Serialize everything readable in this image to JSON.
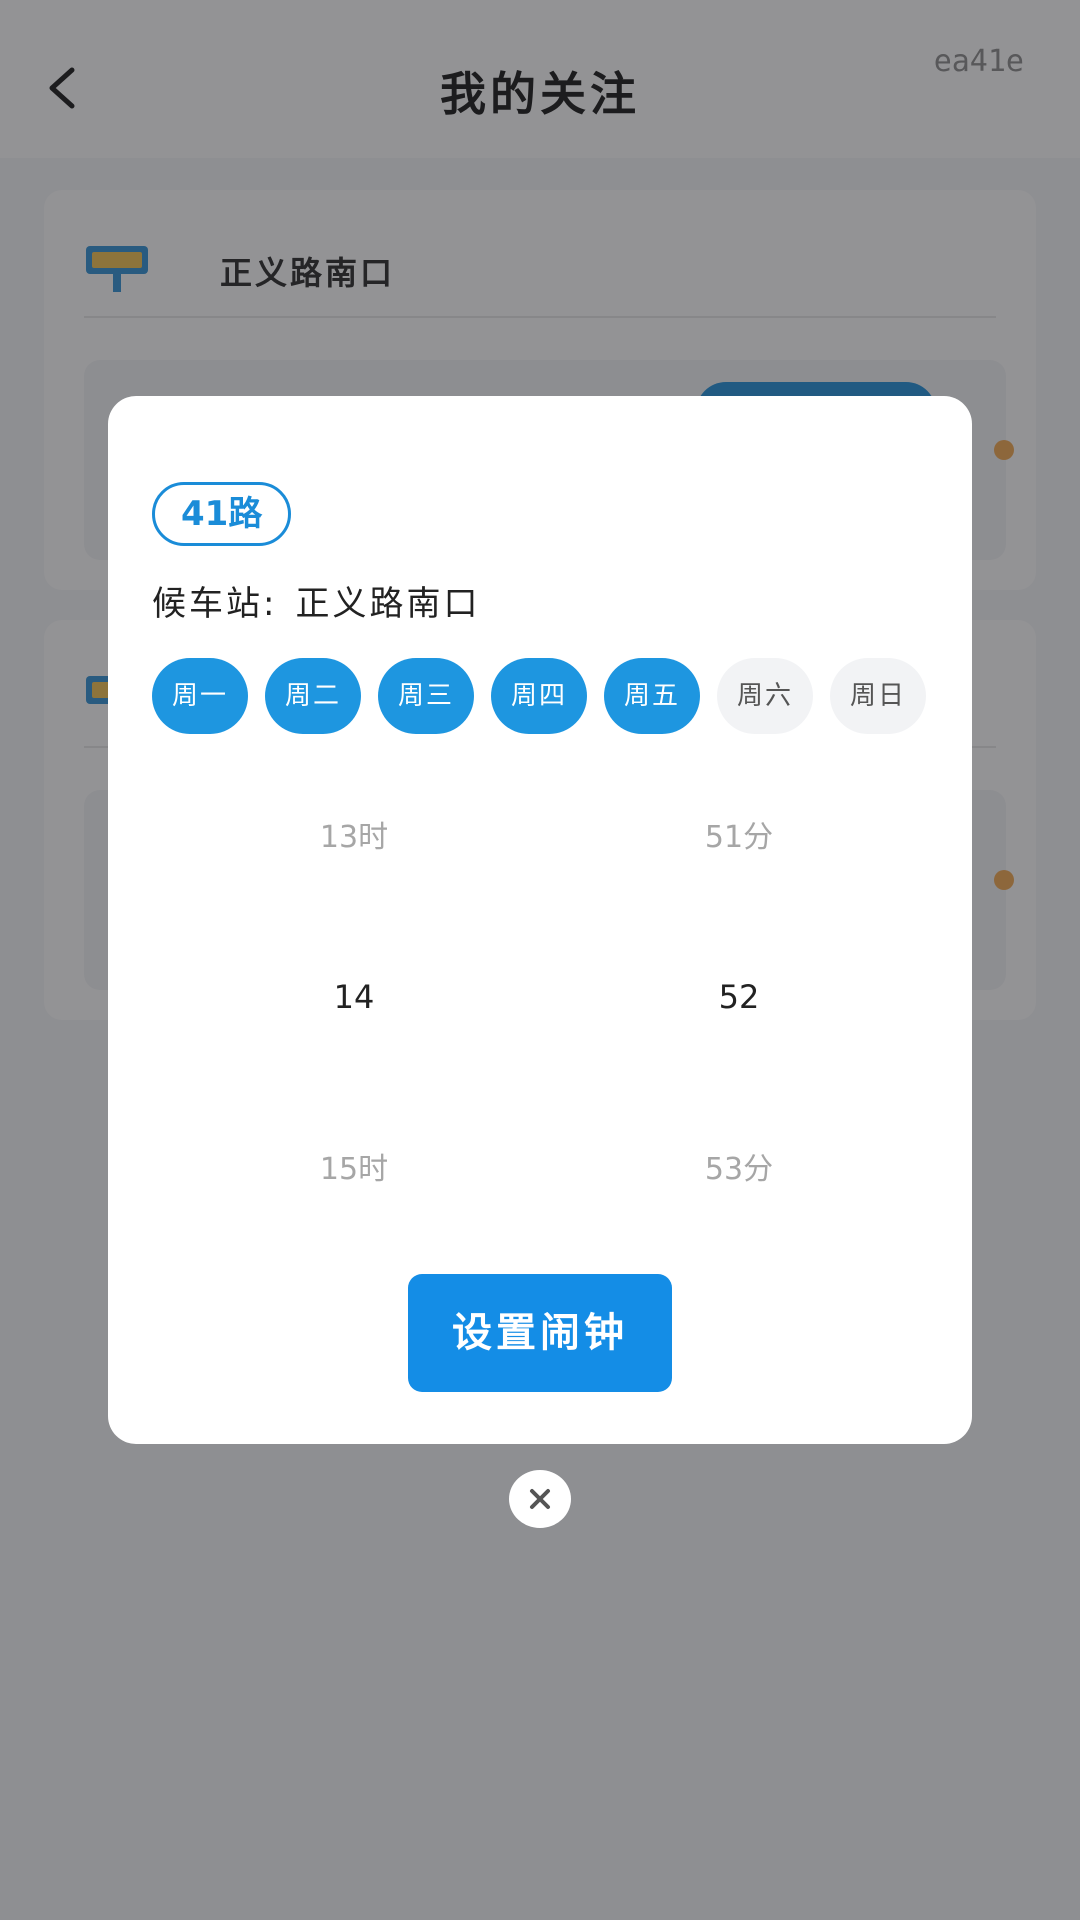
{
  "header": {
    "title": "我的关注",
    "tag": "ea41e"
  },
  "background": {
    "stops": [
      {
        "name": "正义路南口"
      },
      {
        "name": ""
      }
    ]
  },
  "modal": {
    "route": "41路",
    "station_label": "候车站:",
    "station_name": "正义路南口",
    "days": [
      {
        "label": "周一",
        "selected": true
      },
      {
        "label": "周二",
        "selected": true
      },
      {
        "label": "周三",
        "selected": true
      },
      {
        "label": "周四",
        "selected": true
      },
      {
        "label": "周五",
        "selected": true
      },
      {
        "label": "周六",
        "selected": false
      },
      {
        "label": "周日",
        "selected": false
      }
    ],
    "hour": {
      "prev": "13时",
      "current": "14",
      "next": "15时"
    },
    "minute": {
      "prev": "51分",
      "current": "52",
      "next": "53分"
    },
    "set_button": "设置闹钟"
  },
  "colors": {
    "primary": "#1e96e0",
    "accent_orange": "#f2a64b"
  }
}
